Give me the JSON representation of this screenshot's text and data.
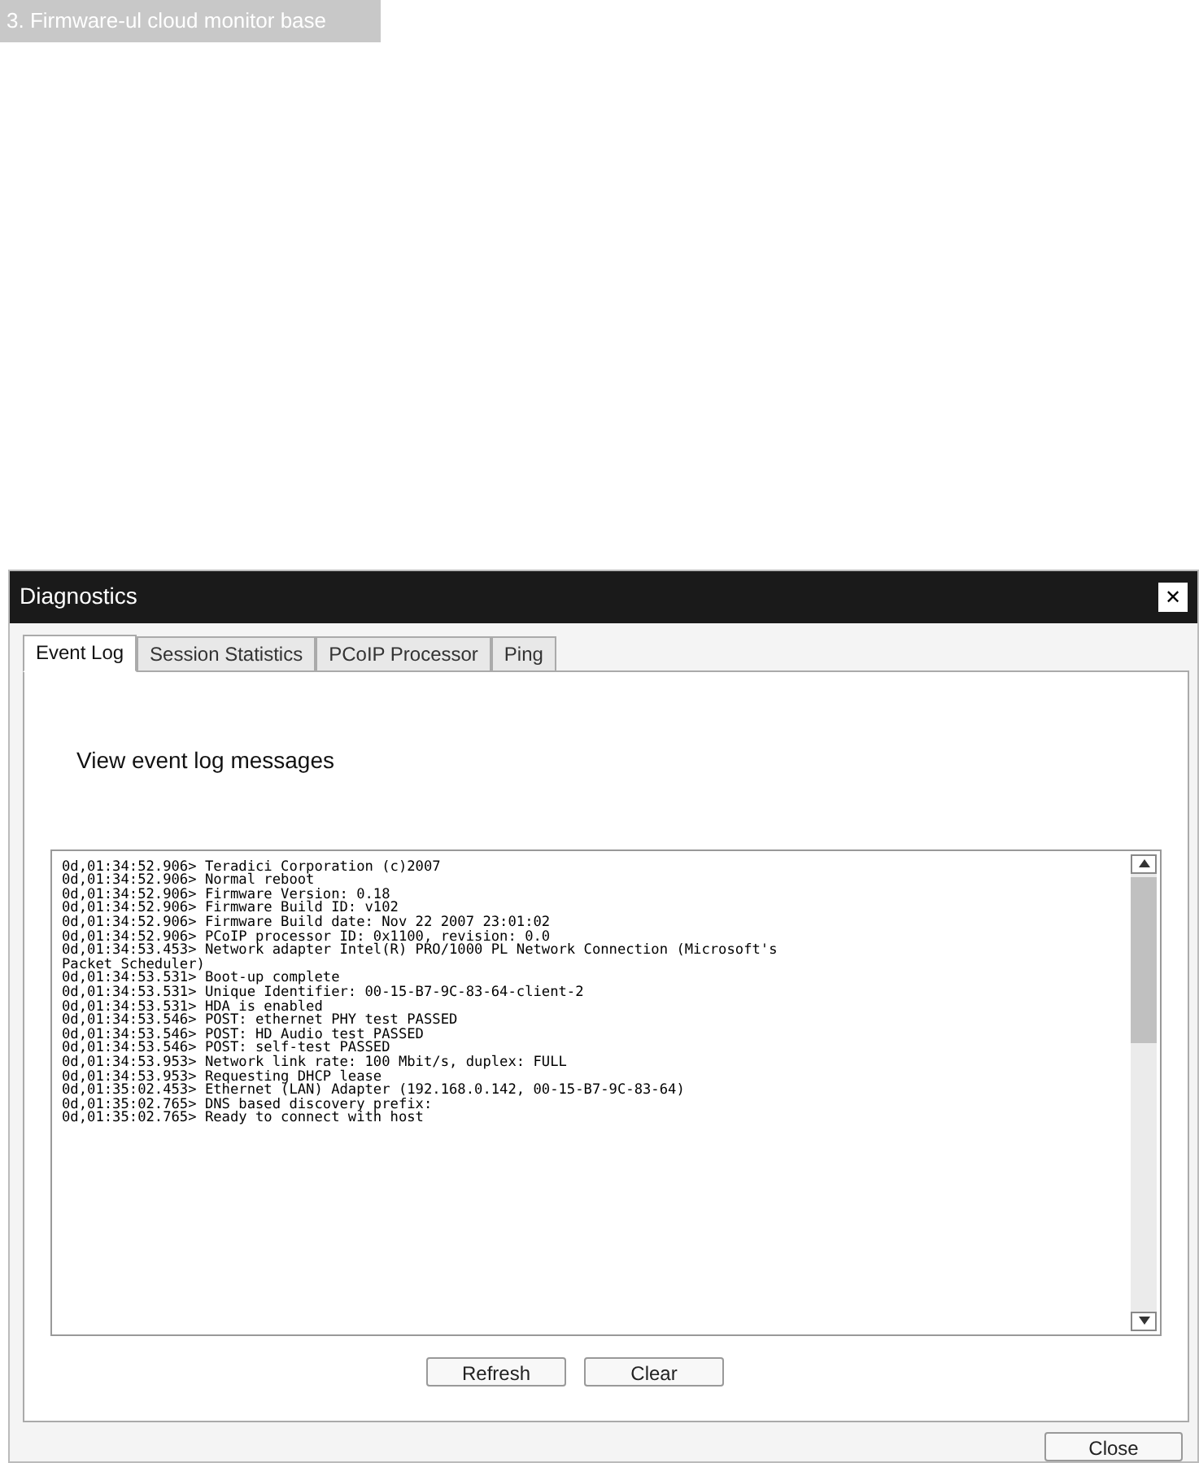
{
  "caption": "3. Firmware-ul cloud monitor base",
  "window": {
    "title": "Diagnostics",
    "close_glyph": "✕"
  },
  "tabs": [
    {
      "label": "Event Log",
      "selected": true
    },
    {
      "label": "Session Statistics",
      "selected": false
    },
    {
      "label": "PCoIP Processor",
      "selected": false
    },
    {
      "label": "Ping",
      "selected": false
    }
  ],
  "heading": "View event log messages",
  "log": [
    "0d,01:34:52.906> Teradici Corporation (c)2007",
    "0d,01:34:52.906> Normal reboot",
    "0d,01:34:52.906> Firmware Version: 0.18",
    "0d,01:34:52.906> Firmware Build ID: v102",
    "0d,01:34:52.906> Firmware Build date: Nov 22 2007 23:01:02",
    "0d,01:34:52.906> PCoIP processor ID: 0x1100, revision: 0.0",
    "0d,01:34:53.453> Network adapter Intel(R) PRO/1000 PL Network Connection (Microsoft's Packet Scheduler)",
    "0d,01:34:53.531> Boot-up complete",
    "0d,01:34:53.531> Unique Identifier: 00-15-B7-9C-83-64-client-2",
    "0d,01:34:53.531> HDA is enabled",
    "0d,01:34:53.546> POST: ethernet PHY test PASSED",
    "0d,01:34:53.546> POST: HD Audio test PASSED",
    "0d,01:34:53.546> POST: self-test PASSED",
    "0d,01:34:53.953> Network link rate: 100 Mbit/s, duplex: FULL",
    "0d,01:34:53.953> Requesting DHCP lease",
    "0d,01:35:02.453> Ethernet (LAN) Adapter (192.168.0.142, 00-15-B7-9C-83-64)",
    "0d,01:35:02.765> DNS based discovery prefix:",
    "0d,01:35:02.765> Ready to connect with host"
  ],
  "log_buttons": [
    "Refresh",
    "Clear"
  ],
  "footer_button": "Close"
}
